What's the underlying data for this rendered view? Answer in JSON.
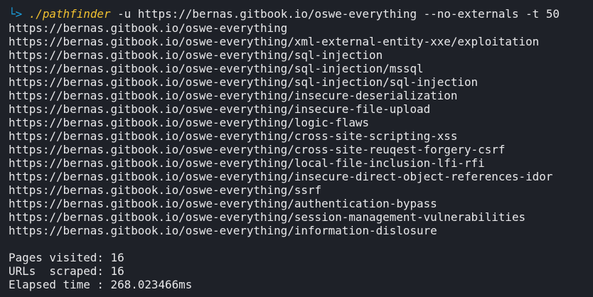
{
  "prompt": {
    "glyph": "└>",
    "command": "./pathfinder",
    "args": " -u https://bernas.gitbook.io/oswe-everything --no-externals -t 50"
  },
  "urls": [
    "https://bernas.gitbook.io/oswe-everything",
    "https://bernas.gitbook.io/oswe-everything/xml-external-entity-xxe/exploitation",
    "https://bernas.gitbook.io/oswe-everything/sql-injection",
    "https://bernas.gitbook.io/oswe-everything/sql-injection/mssql",
    "https://bernas.gitbook.io/oswe-everything/sql-injection/sql-injection",
    "https://bernas.gitbook.io/oswe-everything/insecure-deserialization",
    "https://bernas.gitbook.io/oswe-everything/insecure-file-upload",
    "https://bernas.gitbook.io/oswe-everything/logic-flaws",
    "https://bernas.gitbook.io/oswe-everything/cross-site-scripting-xss",
    "https://bernas.gitbook.io/oswe-everything/cross-site-reuqest-forgery-csrf",
    "https://bernas.gitbook.io/oswe-everything/local-file-inclusion-lfi-rfi",
    "https://bernas.gitbook.io/oswe-everything/insecure-direct-object-references-idor",
    "https://bernas.gitbook.io/oswe-everything/ssrf",
    "https://bernas.gitbook.io/oswe-everything/authentication-bypass",
    "https://bernas.gitbook.io/oswe-everything/session-management-vulnerabilities",
    "https://bernas.gitbook.io/oswe-everything/information-dislosure"
  ],
  "stats": {
    "pages_visited": "Pages visited: 16",
    "urls_scraped": "URLs  scraped: 16",
    "elapsed_time": "Elapsed time : 268.023466ms"
  },
  "colors": {
    "background": "#1e2128",
    "text": "#e8e8ea",
    "prompt_glyph": "#1a9fdd",
    "command": "#f0c030"
  }
}
